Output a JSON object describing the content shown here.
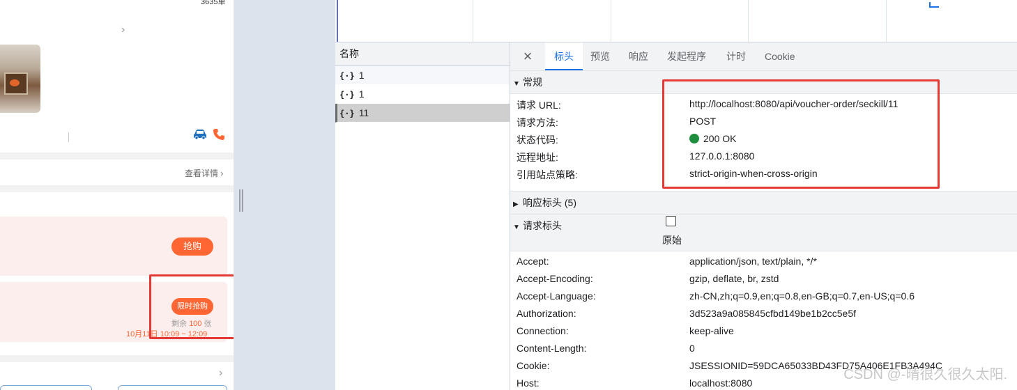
{
  "app": {
    "sold_text": "3635单",
    "more_detail_label": "查看详情",
    "buy_label": "抢购",
    "flash_buy_label": "限时抢购",
    "stock_prefix": "剩余",
    "stock_count": "100",
    "stock_suffix": "张",
    "flash_time": "10月11日 10:09 ~ 12:09",
    "colors": {
      "accent": "#ff6633",
      "card_bg": "#fdeeee",
      "car_icon": "#1f6fbf",
      "phone_icon": "#ff6633"
    }
  },
  "devtools": {
    "list_header": "名称",
    "requests": [
      {
        "name": "1",
        "icon": "json-icon"
      },
      {
        "name": "1",
        "icon": "json-icon"
      },
      {
        "name": "11",
        "icon": "json-icon",
        "selected": true
      }
    ],
    "tabs": [
      "标头",
      "预览",
      "响应",
      "发起程序",
      "计时",
      "Cookie"
    ],
    "active_tab": "标头",
    "general": {
      "title": "常规",
      "rows": [
        {
          "key": "请求 URL:",
          "value": "http://localhost:8080/api/voucher-order/seckill/11"
        },
        {
          "key": "请求方法:",
          "value": "POST"
        },
        {
          "key": "状态代码:",
          "value": "200 OK"
        },
        {
          "key": "远程地址:",
          "value": "127.0.0.1:8080"
        },
        {
          "key": "引用站点策略:",
          "value": "strict-origin-when-cross-origin"
        }
      ]
    },
    "response_headers": {
      "title": "响应标头 (5)"
    },
    "request_headers": {
      "title": "请求标头",
      "raw_label": "原始",
      "rows": [
        {
          "key": "Accept:",
          "value": "application/json, text/plain, */*"
        },
        {
          "key": "Accept-Encoding:",
          "value": "gzip, deflate, br, zstd"
        },
        {
          "key": "Accept-Language:",
          "value": "zh-CN,zh;q=0.9,en;q=0.8,en-GB;q=0.7,en-US;q=0.6"
        },
        {
          "key": "Authorization:",
          "value": "3d523a9a085845cfbd149be1b2cc5e5f"
        },
        {
          "key": "Connection:",
          "value": "keep-alive"
        },
        {
          "key": "Content-Length:",
          "value": "0"
        },
        {
          "key": "Cookie:",
          "value": "JSESSIONID=59DCA65033BD43FD75A406E1FB3A494C"
        },
        {
          "key": "Host:",
          "value": "localhost:8080"
        }
      ]
    },
    "status_color": "#1e8e3e",
    "accent": "#1a73e8"
  },
  "watermark": "CSDN @-晴很久很久太阳."
}
